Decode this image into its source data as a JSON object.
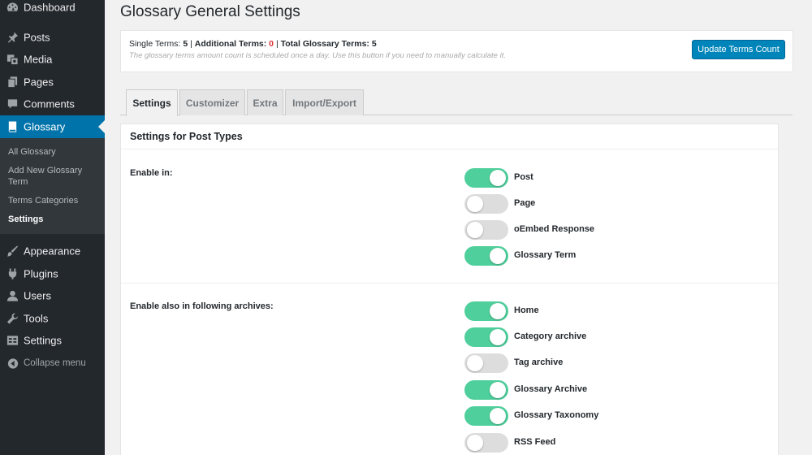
{
  "sidebar": {
    "items": [
      {
        "label": "Dashboard",
        "icon": "dashboard-icon"
      },
      {
        "label": "Posts",
        "icon": "pin-icon"
      },
      {
        "label": "Media",
        "icon": "media-icon"
      },
      {
        "label": "Pages",
        "icon": "pages-icon"
      },
      {
        "label": "Comments",
        "icon": "comment-icon"
      },
      {
        "label": "Glossary",
        "icon": "book-icon",
        "active": true
      },
      {
        "label": "Appearance",
        "icon": "brush-icon"
      },
      {
        "label": "Plugins",
        "icon": "plugin-icon"
      },
      {
        "label": "Users",
        "icon": "user-icon"
      },
      {
        "label": "Tools",
        "icon": "wrench-icon"
      },
      {
        "label": "Settings",
        "icon": "settings-icon"
      }
    ],
    "submenu": [
      "All Glossary",
      "Add New Glossary Term",
      "Terms Categories",
      "Settings"
    ],
    "collapse_label": "Collapse menu"
  },
  "page": {
    "title": "Glossary General Settings"
  },
  "notice": {
    "single_label": "Single Terms:",
    "single_value": "5",
    "sep1": "|",
    "additional_label": "Additional Terms:",
    "additional_value": "0",
    "sep2": "|",
    "total_label": "Total Glossary Terms:",
    "total_value": "5",
    "description": "The glossary terms amount count is scheduled once a day. Use this button if you need to manually calculate it.",
    "button_label": "Update Terms Count"
  },
  "tabs": [
    "Settings",
    "Customizer",
    "Extra",
    "Import/Export"
  ],
  "panel": {
    "title": "Settings for Post Types",
    "enable_in_label": "Enable in:",
    "enable_in": [
      {
        "label": "Post",
        "on": true
      },
      {
        "label": "Page",
        "on": false
      },
      {
        "label": "oEmbed Response",
        "on": false
      },
      {
        "label": "Glossary Term",
        "on": true
      }
    ],
    "archives_label": "Enable also in following archives:",
    "archives": [
      {
        "label": "Home",
        "on": true
      },
      {
        "label": "Category archive",
        "on": true
      },
      {
        "label": "Tag archive",
        "on": false
      },
      {
        "label": "Glossary Archive",
        "on": true
      },
      {
        "label": "Glossary Taxonomy",
        "on": true
      },
      {
        "label": "RSS Feed",
        "on": false
      }
    ]
  },
  "colors": {
    "toggle_on": "#4fcf9c",
    "toggle_off": "#dddddd",
    "active_menu": "#0073aa",
    "button": "#0085ba"
  }
}
